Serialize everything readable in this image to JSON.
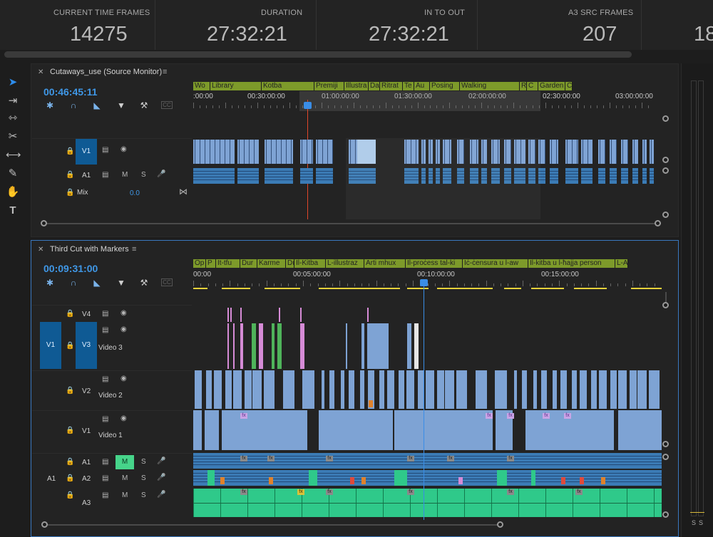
{
  "stats": [
    {
      "label": "CURRENT TIME FRAMES",
      "value": "14275"
    },
    {
      "label": "DURATION",
      "value": "27:32:21"
    },
    {
      "label": "IN TO OUT",
      "value": "27:32:21"
    },
    {
      "label": "A3 SRC FRAMES",
      "value": "207"
    },
    {
      "label": "",
      "value": "18"
    }
  ],
  "tools": [
    "selection-tool",
    "track-select-tool",
    "ripple-edit-tool",
    "razor-tool",
    "slip-tool",
    "pen-tool",
    "hand-tool",
    "type-tool"
  ],
  "source": {
    "title": "Cutaways_use (Source Monitor)",
    "timecode": "00:46:45:11",
    "markers": [
      "Wo",
      "Library",
      "Kotba",
      "Premiji",
      "Illustra",
      "Da",
      "Ritrat",
      "Te",
      "Au",
      "Posing",
      "Walking",
      "R",
      "C",
      "Garden",
      "C"
    ],
    "ruler": [
      ":00:00",
      "00:30:00:00",
      "01:00:00:00",
      "01:30:00:00",
      "02:00:00:00",
      "02:30:00:00",
      "03:00:00:00"
    ],
    "tracks": {
      "v1": "V1",
      "a1": "A1",
      "mix": "Mix",
      "mix_value": "0.0",
      "m": "M",
      "s": "S"
    }
  },
  "sequence": {
    "title": "Third Cut with Markers",
    "timecode": "00:09:31:00",
    "markers": [
      "Op",
      "P",
      "It-tfu",
      "Dur",
      "Karme",
      "Dur",
      "Il-Kitba",
      "L-illustraz",
      "Arti mhux",
      "Il-proċess tal-ki",
      "Iċ-ċensura u l-aw",
      "Il-kitba u l-ħajja person",
      "L-A"
    ],
    "ruler": [
      "00:00",
      "00:05:00:00",
      "00:10:00:00",
      "00:15:00:00"
    ],
    "tracks": {
      "v4": "V4",
      "v3": "V3",
      "v3_name": "Video 3",
      "v2": "V2",
      "v2_name": "Video 2",
      "v1": "V1",
      "v1_name": "Video 1",
      "v1_src": "V1",
      "a1": "A1",
      "a2": "A2",
      "a3": "A3",
      "a1_src": "A1",
      "m": "M",
      "s": "S"
    },
    "fx_label": "fx"
  },
  "right_meter": {
    "labels": [
      "S",
      "S"
    ]
  },
  "colors": {
    "accent": "#2d8ceb",
    "video_clip": "#7ea3d4",
    "audio_clip": "#3b7bb5",
    "audio_green": "#2fc98a",
    "marker": "#7d9a2a",
    "track_target": "#0f5a94"
  }
}
